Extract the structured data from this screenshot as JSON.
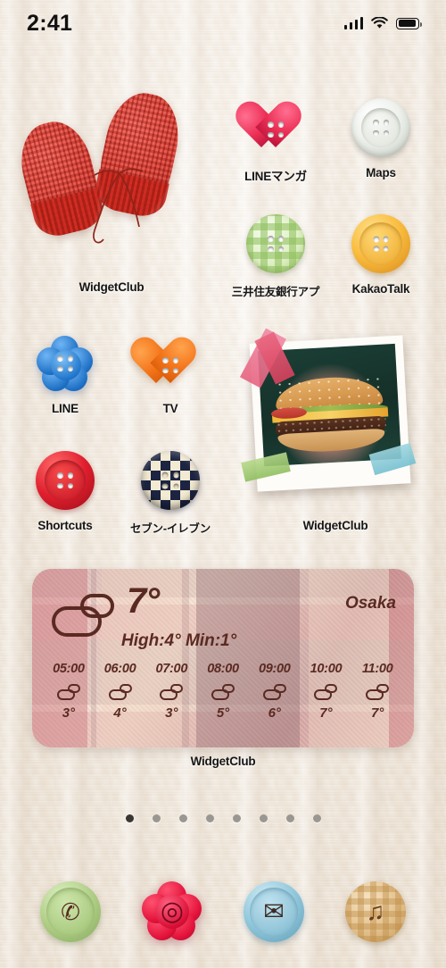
{
  "status_bar": {
    "time": "2:41",
    "signal_icon": "cellular-bars-icon",
    "wifi_icon": "wifi-icon",
    "battery_icon": "battery-icon"
  },
  "home_screen": {
    "widgets": [
      {
        "name": "mittens-photo-widget",
        "label": "WidgetClub",
        "image_subject": "red knitted mittens on white knit background"
      },
      {
        "name": "polaroid-photo-widget",
        "label": "WidgetClub",
        "image_subject": "cheeseburger polaroid with washi tape"
      }
    ],
    "apps": [
      {
        "label": "LINEマンガ",
        "icon": "heart-button-icon",
        "color": "#ec2f55"
      },
      {
        "label": "Maps",
        "icon": "round-button-icon",
        "color": "#e9ece8"
      },
      {
        "label": "三井住友銀行アプ",
        "icon": "gingham-round-button-icon",
        "color": "#a9d17a"
      },
      {
        "label": "KakaoTalk",
        "icon": "round-button-icon",
        "color": "#f6b63c"
      },
      {
        "label": "LINE",
        "icon": "flower-button-icon",
        "color": "#1d6fc4"
      },
      {
        "label": "TV",
        "icon": "heart-button-icon",
        "color": "#f47a25"
      },
      {
        "label": "Shortcuts",
        "icon": "round-button-icon",
        "color": "#e01f2e"
      },
      {
        "label": "セブン-イレブン",
        "icon": "checkered-button-icon",
        "color": "#1c2442"
      }
    ]
  },
  "weather_widget": {
    "label": "WidgetClub",
    "city": "Osaka",
    "current_temp": "7°",
    "high_low": "High:4°  Min:1°",
    "condition_icon": "cloudy-icon",
    "hourly": [
      {
        "time": "05:00",
        "icon": "cloudy-icon",
        "temp": "3°"
      },
      {
        "time": "06:00",
        "icon": "cloudy-icon",
        "temp": "4°"
      },
      {
        "time": "07:00",
        "icon": "cloudy-icon",
        "temp": "3°"
      },
      {
        "time": "08:00",
        "icon": "cloudy-icon",
        "temp": "5°"
      },
      {
        "time": "09:00",
        "icon": "cloudy-icon",
        "temp": "6°"
      },
      {
        "time": "10:00",
        "icon": "cloudy-icon",
        "temp": "7°"
      },
      {
        "time": "11:00",
        "icon": "cloudy-icon",
        "temp": "7°"
      }
    ]
  },
  "page_indicator": {
    "total": 8,
    "active": 1
  },
  "dock": [
    {
      "name": "phone",
      "icon": "phone-icon",
      "glyph": "✆",
      "color": "#a9c97e"
    },
    {
      "name": "safari",
      "icon": "compass-icon",
      "glyph": "◎",
      "color": "#e3123a"
    },
    {
      "name": "mail",
      "icon": "envelope-icon",
      "glyph": "✉",
      "color": "#7ec0da"
    },
    {
      "name": "music",
      "icon": "music-note-icon",
      "glyph": "♫",
      "color": "#dcb273"
    }
  ]
}
